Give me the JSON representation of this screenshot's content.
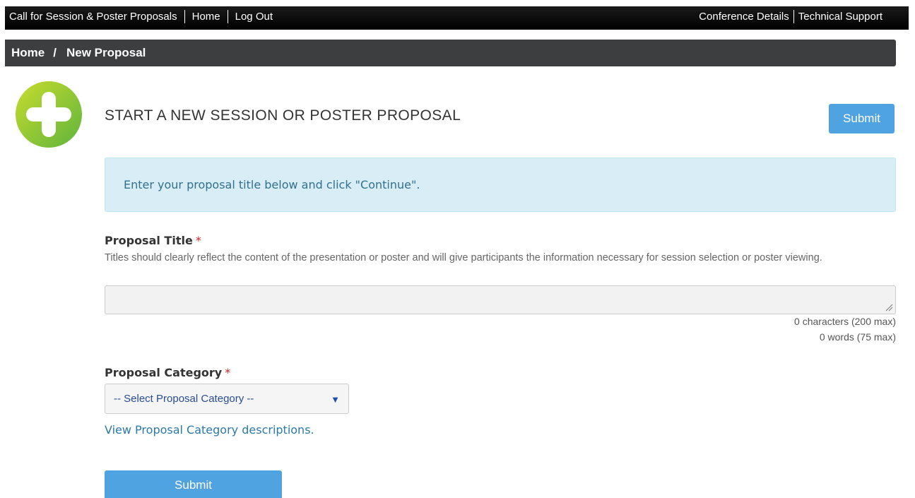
{
  "topbar": {
    "call_for_proposals": "Call for Session & Poster Proposals",
    "home": "Home",
    "logout": "Log Out",
    "conference_details": "Conference Details",
    "technical_support": "Technical Support"
  },
  "breadcrumb": {
    "home": "Home",
    "separator": "/",
    "current": "New Proposal"
  },
  "page": {
    "title": "START A NEW SESSION OR POSTER PROPOSAL",
    "submit_label": "Submit",
    "info_message": "Enter your proposal title below and click \"Continue\"."
  },
  "form": {
    "proposal_title": {
      "label": "Proposal Title",
      "required_mark": "*",
      "help": "Titles should clearly reflect the content of the presentation or poster and will give participants the information necessary for session selection or poster viewing.",
      "value": "",
      "char_count": "0 characters (200 max)",
      "word_count": "0 words (75 max)"
    },
    "proposal_category": {
      "label": "Proposal Category",
      "required_mark": "*",
      "selected": "-- Select Proposal Category --",
      "descriptions_link": "View Proposal Category descriptions."
    },
    "submit_label": "Submit"
  },
  "colors": {
    "accent": "#4fa3e0",
    "info_bg": "#d9edf7",
    "required": "#cc2222",
    "icon_green": "#8cc63f"
  },
  "icons": {
    "plus": "plus-circle-icon",
    "caret": "caret-down-icon",
    "resize": "resize-grip-icon"
  }
}
